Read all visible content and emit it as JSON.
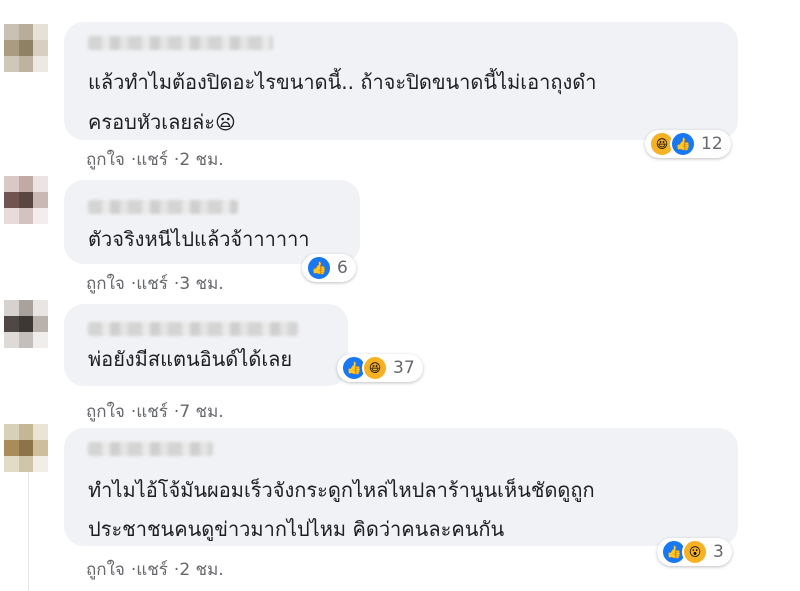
{
  "comments": [
    {
      "lines": [
        "แล้วทำไมต้องปิดอะไรขนาดนี้.. ถ้าจะปิดขนาดนี้ไม่เอาถุงดำ",
        "ครอบหัวเลยล่ะ😦"
      ],
      "reactions": [
        "haha",
        "like"
      ],
      "reaction_count": "12",
      "like_label": "ถูกใจ",
      "reply_label": "แชร์",
      "time": "2 ชม."
    },
    {
      "lines": [
        "ตัวจริงหนีไปแล้วจ้าาาาาา"
      ],
      "reactions": [
        "like"
      ],
      "reaction_count": "6",
      "like_label": "ถูกใจ",
      "reply_label": "แชร์",
      "time": "3 ชม."
    },
    {
      "lines": [
        "พ่อยังมีสแตนอินด์ได้เลย"
      ],
      "reactions": [
        "like",
        "haha"
      ],
      "reaction_count": "37",
      "like_label": "ถูกใจ",
      "reply_label": "แชร์",
      "time": "7 ชม."
    },
    {
      "lines": [
        "ทำไมไอ้โจ้มันผอมเร็วจังกระดูกไหล่ไหปลาร้านูนเห็นชัดดูถูก",
        "ประชาชนคนดูข่าวมากไปไหม คิดว่าคนละคนกัน"
      ],
      "reactions": [
        "like",
        "wow"
      ],
      "reaction_count": "3",
      "like_label": "ถูกใจ",
      "reply_label": "แชร์",
      "time": "2 ชม."
    }
  ],
  "separator": "·",
  "colors": {
    "like": "#1877f2",
    "haha": "#f7b125",
    "bubble": "#f0f2f5",
    "meta": "#65676b"
  },
  "icons": {
    "like": "thumbs-up-icon",
    "haha": "laughing-face-icon",
    "wow": "surprised-face-icon"
  }
}
